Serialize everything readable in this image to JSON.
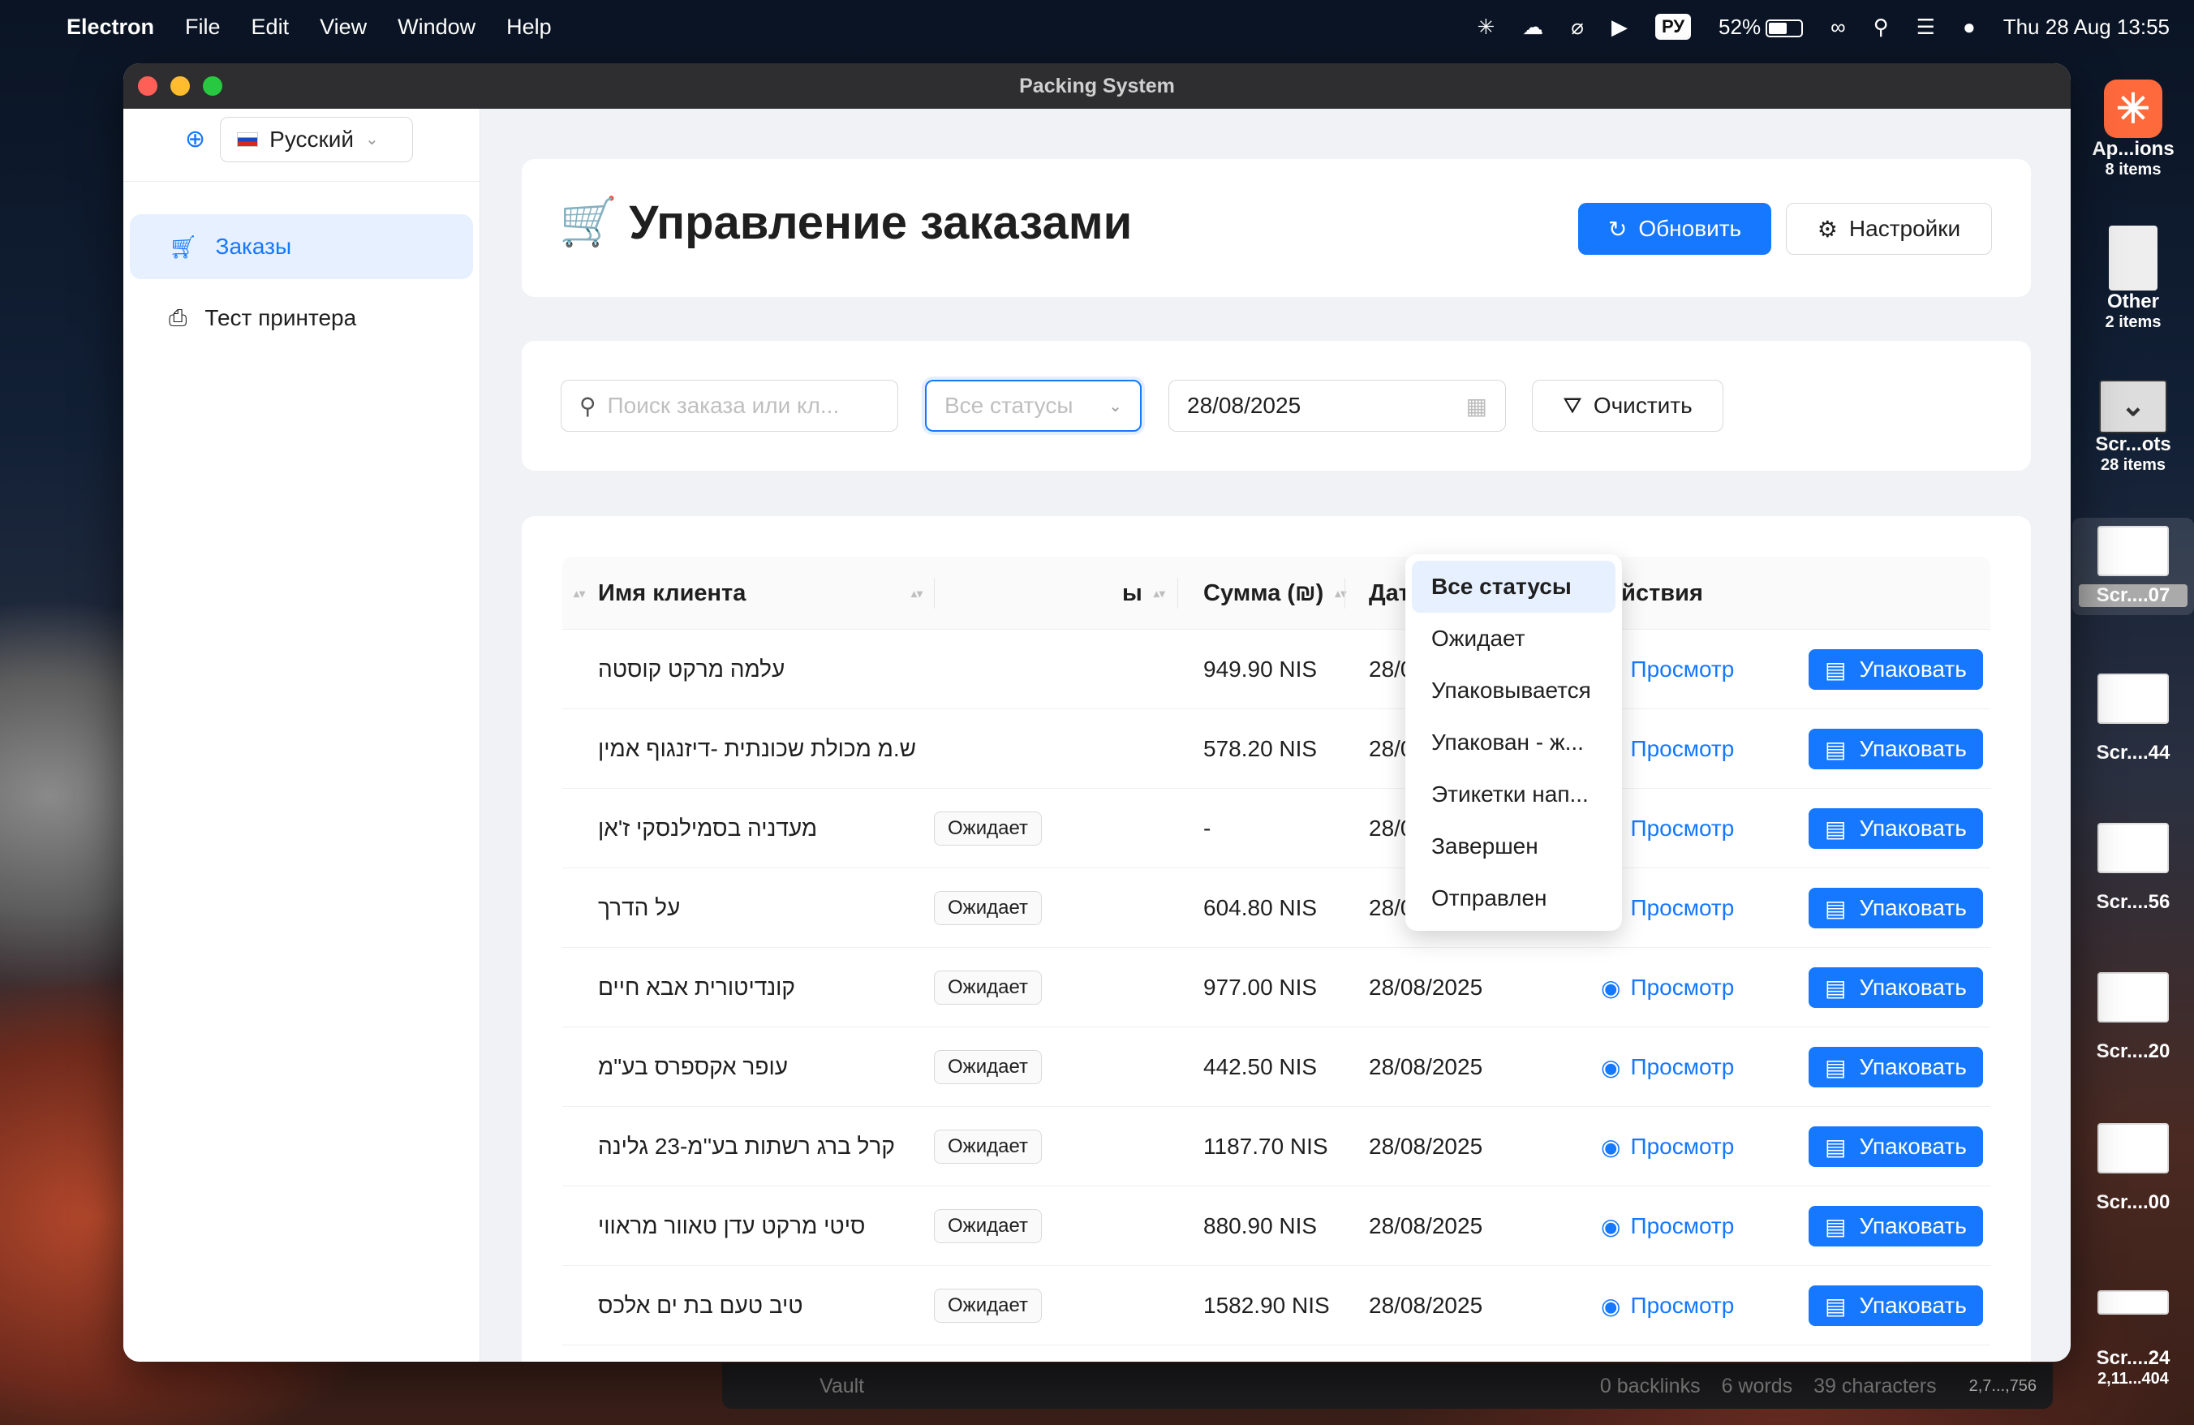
{
  "menubar": {
    "app": "Electron",
    "items": [
      "File",
      "Edit",
      "View",
      "Window",
      "Help"
    ],
    "input_source": "РУ",
    "battery": "52%",
    "datetime": "Thu 28 Aug  13:55"
  },
  "window": {
    "title": "Packing System"
  },
  "sidebar": {
    "language": "Русский",
    "items": [
      {
        "label": "Заказы",
        "active": true
      },
      {
        "label": "Тест принтера",
        "active": false
      }
    ]
  },
  "header": {
    "title": "Управление заказами",
    "refresh": "Обновить",
    "settings": "Настройки"
  },
  "filters": {
    "search_placeholder": "Поиск заказа или кл...",
    "status_placeholder": "Все статусы",
    "date": "28/08/2025",
    "clear": "Очистить"
  },
  "status_options": [
    "Все статусы",
    "Ожидает",
    "Упаковывается",
    "Упакован - ж...",
    "Этикетки нап...",
    "Завершен",
    "Отправлен"
  ],
  "table": {
    "columns": [
      "Имя клиента",
      "ы",
      "Сумма (₪)",
      "Дата создания",
      "Действия"
    ],
    "view_label": "Просмотр",
    "pack_label": "Упаковать",
    "rows": [
      {
        "client": "עלמה מרקט קוסטה",
        "status": "",
        "sum": "949.90 NIS",
        "date": "28/08/2025"
      },
      {
        "client": "ש.מ מכולת שכונתית -דיזנגוף אמין",
        "status": "",
        "sum": "578.20 NIS",
        "date": "28/08/2025"
      },
      {
        "client": "מעדניה בסמילנסקי ז'אן",
        "status": "Ожидает",
        "sum": "-",
        "date": "28/08/2025"
      },
      {
        "client": "על הדרך",
        "status": "Ожидает",
        "sum": "604.80 NIS",
        "date": "28/08/2025"
      },
      {
        "client": "קונדיטורית אבא חיים",
        "status": "Ожидает",
        "sum": "977.00 NIS",
        "date": "28/08/2025"
      },
      {
        "client": "עופר אקספרס בע\"מ",
        "status": "Ожидает",
        "sum": "442.50 NIS",
        "date": "28/08/2025"
      },
      {
        "client": "קרל ברג רשתות בע''מ-23 גלינה",
        "status": "Ожидает",
        "sum": "1187.70 NIS",
        "date": "28/08/2025"
      },
      {
        "client": "סיטי מרקט עדן טאוור מראווי",
        "status": "Ожидает",
        "sum": "880.90 NIS",
        "date": "28/08/2025"
      },
      {
        "client": "טיב טעם בת ים אלכס",
        "status": "Ожидает",
        "sum": "1582.90 NIS",
        "date": "28/08/2025"
      }
    ]
  },
  "dock": [
    {
      "name": "Ap...ions",
      "count": "8 items"
    },
    {
      "name": "Other",
      "count": "2 items"
    },
    {
      "name": "Scr...ots",
      "count": "28 items"
    },
    {
      "name": "Scr....07",
      "count": ""
    },
    {
      "name": "Scr....44",
      "count": ""
    },
    {
      "name": "Scr....56",
      "count": ""
    },
    {
      "name": "Scr....20",
      "count": ""
    },
    {
      "name": "Scr....00",
      "count": ""
    },
    {
      "name": "Scr....24",
      "count": "2,11...404"
    }
  ],
  "behind": {
    "vault": "Vault",
    "backlinks": "0 backlinks",
    "words": "6 words",
    "chars": "39 characters",
    "fileinfo": "2,7...,756"
  }
}
